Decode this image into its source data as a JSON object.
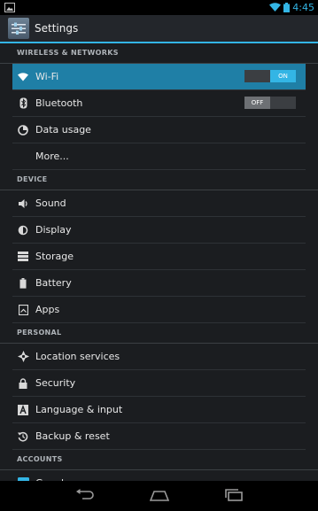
{
  "status": {
    "time": "4:45"
  },
  "header": {
    "title": "Settings"
  },
  "sections": {
    "wireless": "WIRELESS & NETWORKS",
    "device": "DEVICE",
    "personal": "PERSONAL",
    "accounts": "ACCOUNTS"
  },
  "items": {
    "wifi": {
      "label": "Wi-Fi",
      "toggle": "ON",
      "icon": "wifi-icon"
    },
    "bluetooth": {
      "label": "Bluetooth",
      "toggle": "OFF",
      "icon": "bluetooth-icon"
    },
    "data_usage": {
      "label": "Data usage",
      "icon": "data-usage-icon"
    },
    "more": {
      "label": "More..."
    },
    "sound": {
      "label": "Sound",
      "icon": "sound-icon"
    },
    "display": {
      "label": "Display",
      "icon": "display-icon"
    },
    "storage": {
      "label": "Storage",
      "icon": "storage-icon"
    },
    "battery": {
      "label": "Battery",
      "icon": "battery-icon"
    },
    "apps": {
      "label": "Apps",
      "icon": "apps-icon"
    },
    "location": {
      "label": "Location services",
      "icon": "location-icon"
    },
    "security": {
      "label": "Security",
      "icon": "lock-icon"
    },
    "language": {
      "label": "Language & input",
      "icon": "language-icon"
    },
    "backup": {
      "label": "Backup & reset",
      "icon": "backup-icon"
    },
    "google": {
      "label": "Google",
      "icon": "google-icon"
    }
  },
  "colors": {
    "accent": "#33b5e5",
    "background": "#1b1d20",
    "selected": "#1f7fa6"
  }
}
